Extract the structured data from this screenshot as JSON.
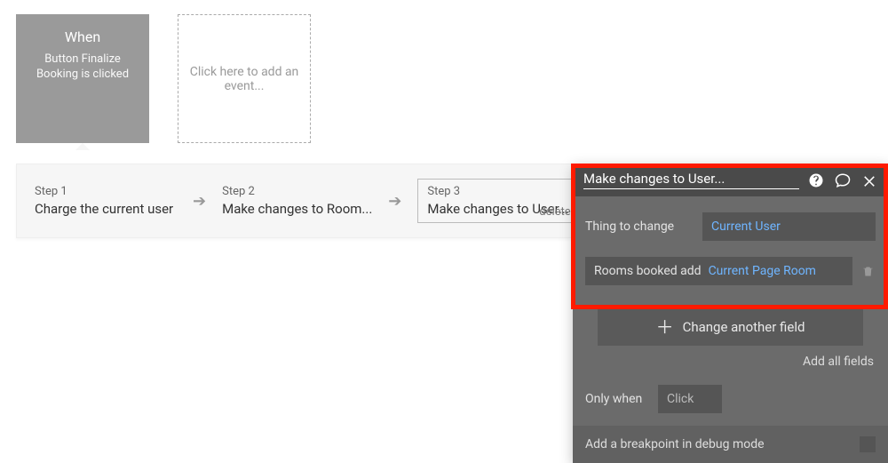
{
  "event_card": {
    "title": "When",
    "subtitle": "Button Finalize Booking is clicked"
  },
  "add_event_placeholder": "Click here to add an event...",
  "steps": [
    {
      "label": "Step 1",
      "text": "Charge the current user"
    },
    {
      "label": "Step 2",
      "text": "Make changes to Room..."
    },
    {
      "label": "Step 3",
      "text": "Make changes to User...",
      "delete": "delete"
    }
  ],
  "panel": {
    "title": "Make changes to User...",
    "thing_to_change_label": "Thing to change",
    "thing_to_change_value": "Current User",
    "field_expr_prefix": "Rooms booked add",
    "field_expr_link": "Current Page Room",
    "change_another": "Change another field",
    "add_all": "Add all fields",
    "only_when_label": "Only when",
    "only_when_value": "Click",
    "breakpoint": "Add a breakpoint in debug mode"
  }
}
